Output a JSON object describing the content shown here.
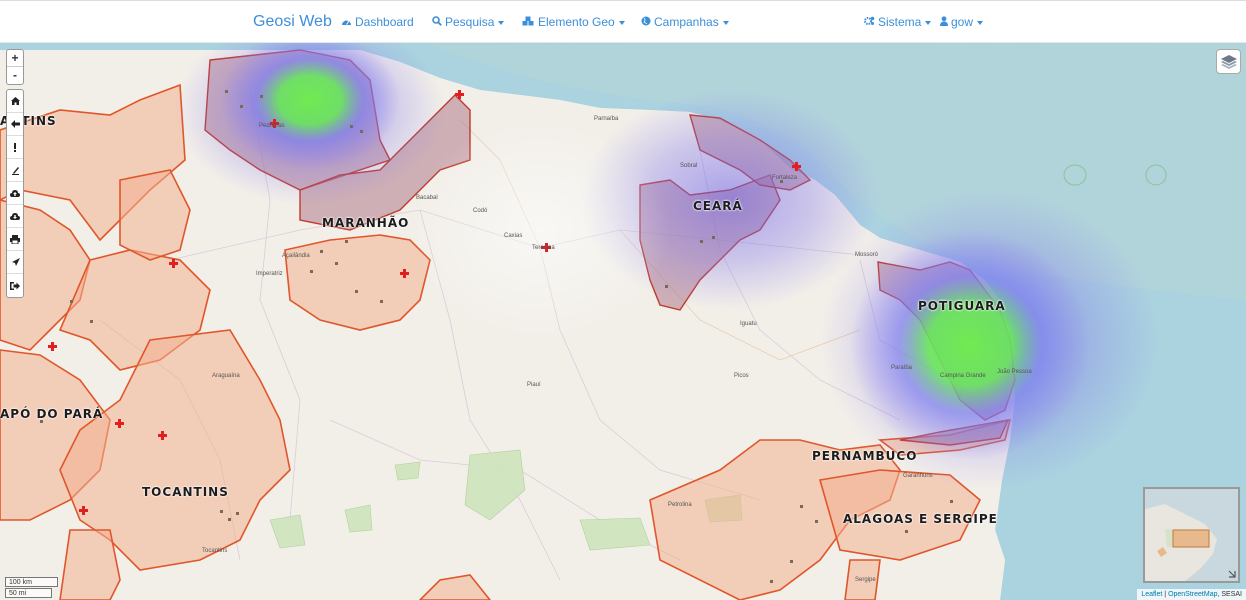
{
  "nav": {
    "brand": "Geosi Web",
    "dashboard": "Dashboard",
    "pesquisa": "Pesquisa",
    "elemento_geo": "Elemento Geo",
    "campanhas": "Campanhas",
    "sistema": "Sistema",
    "user": "gow"
  },
  "map": {
    "zoom_in": "+",
    "zoom_out": "-",
    "region_labels": {
      "tocantins_top": "ANTINS",
      "maranhao": "MARANHÃO",
      "ceara": "CEARÁ",
      "potiguara": "POTIGUARA",
      "pernambuco": "PERNAMBUCO",
      "alagoas": "ALAGOAS E SERGIPE",
      "tocantins": "TOCANTINS",
      "amapa": "APÓ DO PARÁ"
    },
    "cities": {
      "parnaiba": "Parnaíba",
      "sobral": "Sobral",
      "fortaleza": "Fortaleza",
      "caxias": "Caxias",
      "teresina": "Teresina",
      "bacabal": "Bacabal",
      "codo": "Codó",
      "imperatriz": "Imperatriz",
      "mossoro": "Mossoró",
      "natal": "Natal",
      "campina": "Campina Grande",
      "joao_pessoa": "João Pessoa",
      "picos": "Picos",
      "iguatu": "Iguatu",
      "crato": "Crato",
      "petrolina": "Petrolina",
      "piaui": "Piauí",
      "paraiba": "Paraíba",
      "garanhuns": "Garanhuns",
      "araguaina": "Araguaína",
      "sergipe": "Sergipe",
      "tocantins_river": "Tocantins",
      "acailandia": "Açailândia",
      "balsas": "Balsas",
      "carolina": "Carolina",
      "pedreiras": "Pedreiras"
    },
    "scale": {
      "km": "100 km",
      "mi": "50 mi"
    },
    "attribution": {
      "leaflet": "Leaflet",
      "sep": " | ",
      "osm": "OpenStreetMap",
      "rest": ", SESAI"
    }
  },
  "icons": {
    "dashboard": "dashboard-icon",
    "pesquisa": "search-icon",
    "elemento_geo": "cubes-icon",
    "campanhas": "globe-icon",
    "sistema": "cogs-icon",
    "user": "user-icon",
    "layers": "layers-icon"
  },
  "colors": {
    "link": "#3b8fd9",
    "polygon_fill": "#f2b08f",
    "polygon_stroke": "#e0562a",
    "marker": "#e02020"
  }
}
